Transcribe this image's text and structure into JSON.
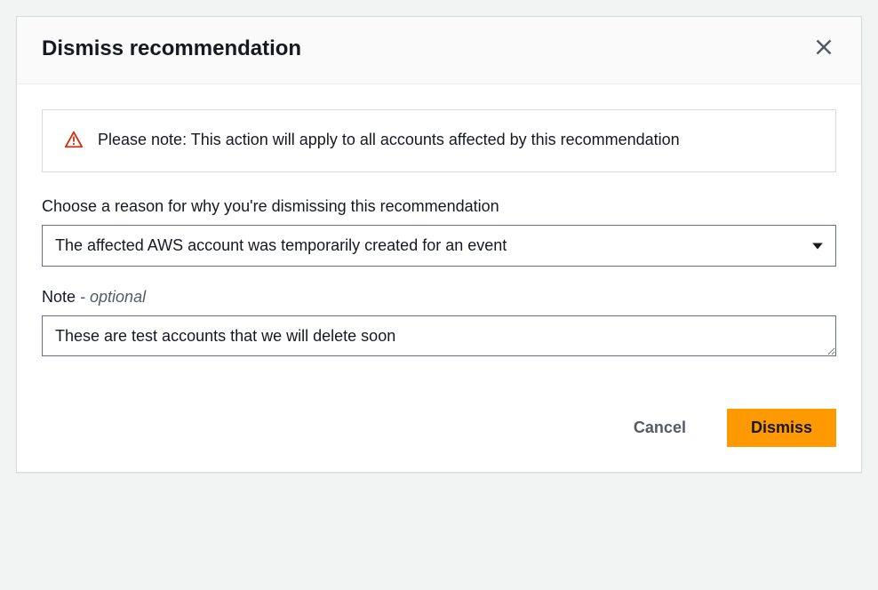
{
  "modal": {
    "title": "Dismiss recommendation",
    "alert": {
      "text": "Please note: This action will apply to all accounts affected by this recommendation"
    },
    "reason": {
      "label": "Choose a reason for why you're dismissing this recommendation",
      "selected": "The affected AWS account was temporarily created for an event"
    },
    "note": {
      "label_prefix": "Note",
      "label_optional": " - optional",
      "value": "These are test accounts that we will delete soon"
    },
    "buttons": {
      "cancel": "Cancel",
      "dismiss": "Dismiss"
    }
  }
}
